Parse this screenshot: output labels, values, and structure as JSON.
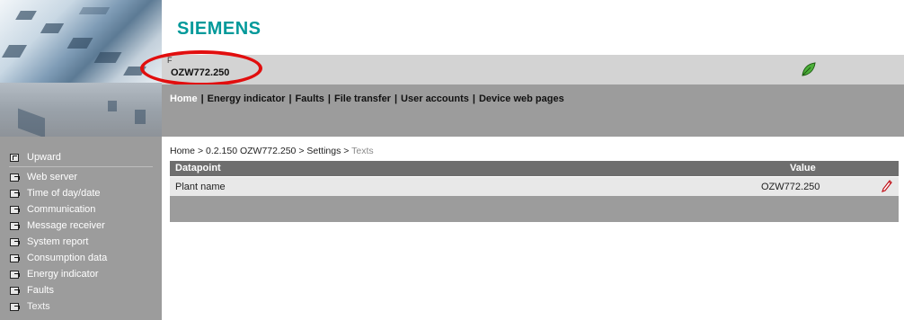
{
  "brand": {
    "logo_text": "SIEMENS"
  },
  "device": {
    "name": "OZW772.250",
    "mark": "F",
    "status_icon": "leaf-icon"
  },
  "nav": {
    "items": [
      {
        "label": "Home",
        "current": true
      },
      {
        "label": "Energy indicator"
      },
      {
        "label": "Faults"
      },
      {
        "label": "File transfer"
      },
      {
        "label": "User accounts"
      },
      {
        "label": "Device web pages"
      }
    ],
    "separator": "|"
  },
  "sidebar": {
    "upward": {
      "label": "Upward",
      "icon": "upward-icon"
    },
    "items": [
      {
        "label": "Web server"
      },
      {
        "label": "Time of day/date"
      },
      {
        "label": "Communication"
      },
      {
        "label": "Message receiver"
      },
      {
        "label": "System report"
      },
      {
        "label": "Consumption data"
      },
      {
        "label": "Energy indicator"
      },
      {
        "label": "Faults"
      },
      {
        "label": "Texts",
        "active": true
      }
    ]
  },
  "breadcrumb": {
    "parts": [
      "Home",
      "0.2.150 OZW772.250",
      "Settings"
    ],
    "current": "Texts",
    "separator": ">"
  },
  "table": {
    "columns": {
      "datapoint": "Datapoint",
      "value": "Value"
    },
    "rows": [
      {
        "datapoint": "Plant name",
        "value": "OZW772.250",
        "action_icon": "edit-pencil-icon"
      }
    ]
  },
  "colors": {
    "brand_teal": "#00999a",
    "highlight_red": "#e10e0e",
    "sidebar_gray": "#9c9c9c",
    "header_gray": "#d3d3d3",
    "table_header": "#6e6e6e"
  }
}
